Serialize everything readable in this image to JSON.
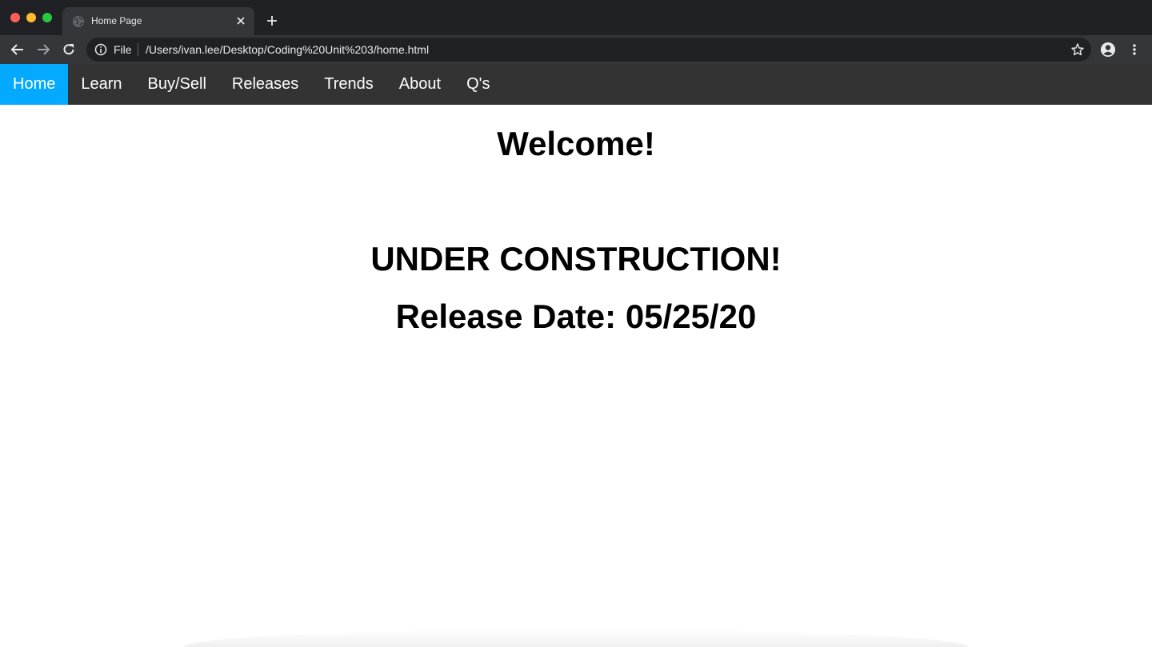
{
  "browser": {
    "tab_title": "Home Page",
    "address_scheme": "File",
    "address_url": "/Users/ivan.lee/Desktop/Coding%20Unit%203/home.html",
    "icons": {
      "back": "arrow-left-icon",
      "forward": "arrow-right-icon",
      "reload": "reload-icon",
      "info": "info-icon",
      "star": "star-icon",
      "profile": "profile-icon",
      "menu": "kebab-menu-icon",
      "new_tab": "plus-icon",
      "tab_close": "close-icon"
    }
  },
  "nav": {
    "items": [
      {
        "label": "Home"
      },
      {
        "label": "Learn"
      },
      {
        "label": "Buy/Sell"
      },
      {
        "label": "Releases"
      },
      {
        "label": "Trends"
      },
      {
        "label": "About"
      },
      {
        "label": "Q's"
      }
    ],
    "active_index": 0,
    "bar_color": "#333333",
    "active_color": "#04AAFF"
  },
  "main": {
    "welcome": "Welcome!",
    "construction": "UNDER CONSTRUCTION!",
    "release_date": "Release Date: 05/25/20"
  }
}
